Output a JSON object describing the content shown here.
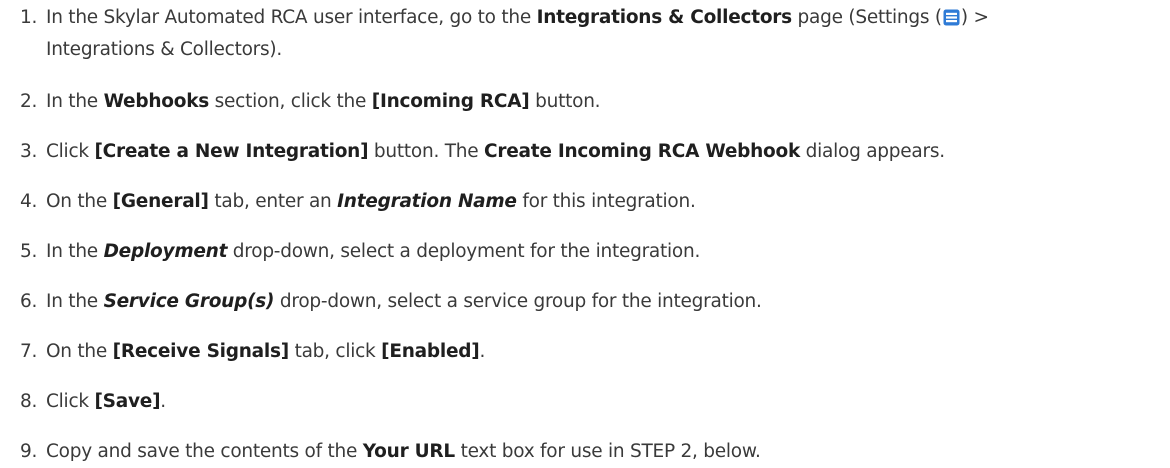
{
  "steps": [
    {
      "number": "1.",
      "parts": {
        "a": "In the Skylar Automated RCA user interface, go to the ",
        "b": "Integrations & Collectors",
        "c": " page (Settings (",
        "d": ") >",
        "e": "Integrations & Collectors)."
      },
      "icon": "settings-menu-icon"
    },
    {
      "number": "2.",
      "parts": {
        "a": "In the ",
        "b": "Webhooks",
        "c": " section, click the ",
        "d": "[Incoming RCA]",
        "e": " button."
      }
    },
    {
      "number": "3.",
      "parts": {
        "a": "Click ",
        "b": "[Create a New Integration]",
        "c": " button. The ",
        "d": "Create Incoming RCA Webhook",
        "e": " dialog appears."
      }
    },
    {
      "number": "4.",
      "parts": {
        "a": "On the ",
        "b": "[General]",
        "c": " tab, enter an ",
        "d": "Integration Name",
        "e": " for this integration."
      }
    },
    {
      "number": "5.",
      "parts": {
        "a": "In the ",
        "b": "Deployment",
        "c": " drop-down, select a deployment for the integration."
      }
    },
    {
      "number": "6.",
      "parts": {
        "a": "In the ",
        "b": "Service Group(s)",
        "c": " drop-down, select a service group for the integration."
      }
    },
    {
      "number": "7.",
      "parts": {
        "a": "On the ",
        "b": "[Receive Signals]",
        "c": " tab, click ",
        "d": "[Enabled]",
        "e": "."
      }
    },
    {
      "number": "8.",
      "parts": {
        "a": "Click ",
        "b": "[Save]",
        "c": "."
      }
    },
    {
      "number": "9.",
      "parts": {
        "a": "Copy and save the contents of the ",
        "b": "Your URL",
        "c": " text box for use in STEP 2, below."
      }
    }
  ],
  "colors": {
    "icon_blue": "#2f7bd6",
    "text": "#3a3a3a"
  }
}
